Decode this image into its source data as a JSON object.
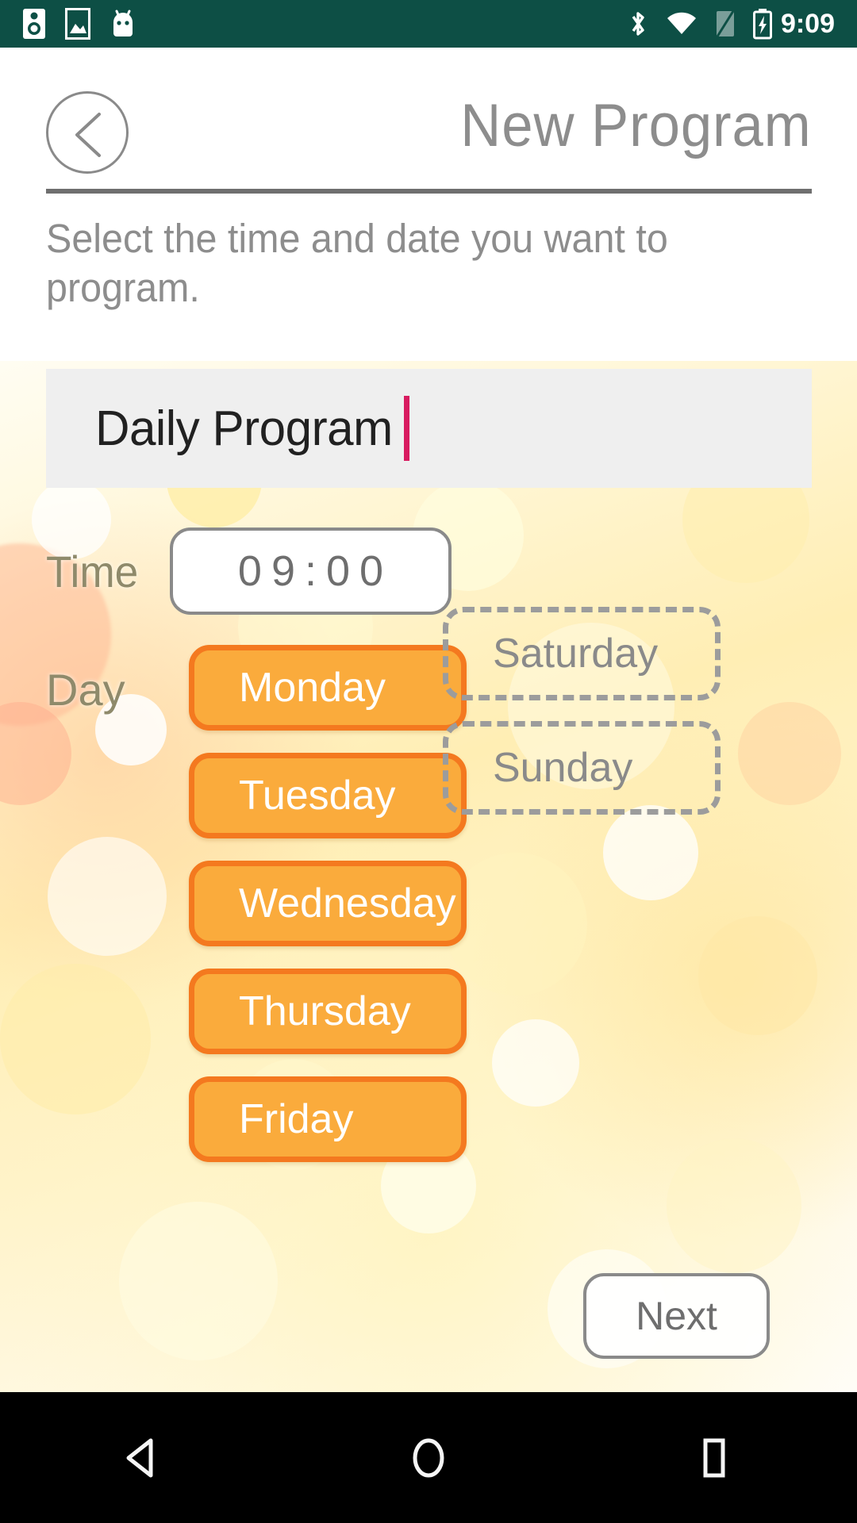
{
  "status_bar": {
    "time": "9:09",
    "left_icons": [
      "speaker-icon",
      "image-icon",
      "android-robot-icon"
    ],
    "right_icons": [
      "bluetooth-icon",
      "wifi-icon",
      "sim-card-icon",
      "battery-charging-icon"
    ],
    "background_color": "#0D4F45"
  },
  "header": {
    "back_icon": "back-chevron-icon",
    "title": "New Program",
    "subtitle": "Select the time and date you want to program."
  },
  "name_field": {
    "value": "Daily Program",
    "placeholder": "Program name",
    "caret_color": "#D81B60",
    "background_color": "#EFEFEF"
  },
  "time_row": {
    "label": "Time",
    "value": "09:00"
  },
  "day_row": {
    "label": "Day",
    "selected_color": "#FAAB3C",
    "selected_border_color": "#F4791F",
    "unselected_border_color": "#9C9C9C",
    "weekdays": [
      {
        "label": "Monday",
        "selected": true
      },
      {
        "label": "Tuesday",
        "selected": true
      },
      {
        "label": "Wednesday",
        "selected": true
      },
      {
        "label": "Thursday",
        "selected": true
      },
      {
        "label": "Friday",
        "selected": true
      }
    ],
    "weekend": [
      {
        "label": "Saturday",
        "selected": false
      },
      {
        "label": "Sunday",
        "selected": false
      }
    ]
  },
  "footer": {
    "next_label": "Next"
  },
  "nav_bar": {
    "back_icon": "triangle-back-icon",
    "home_icon": "circle-home-icon",
    "recents_icon": "square-recents-icon"
  }
}
